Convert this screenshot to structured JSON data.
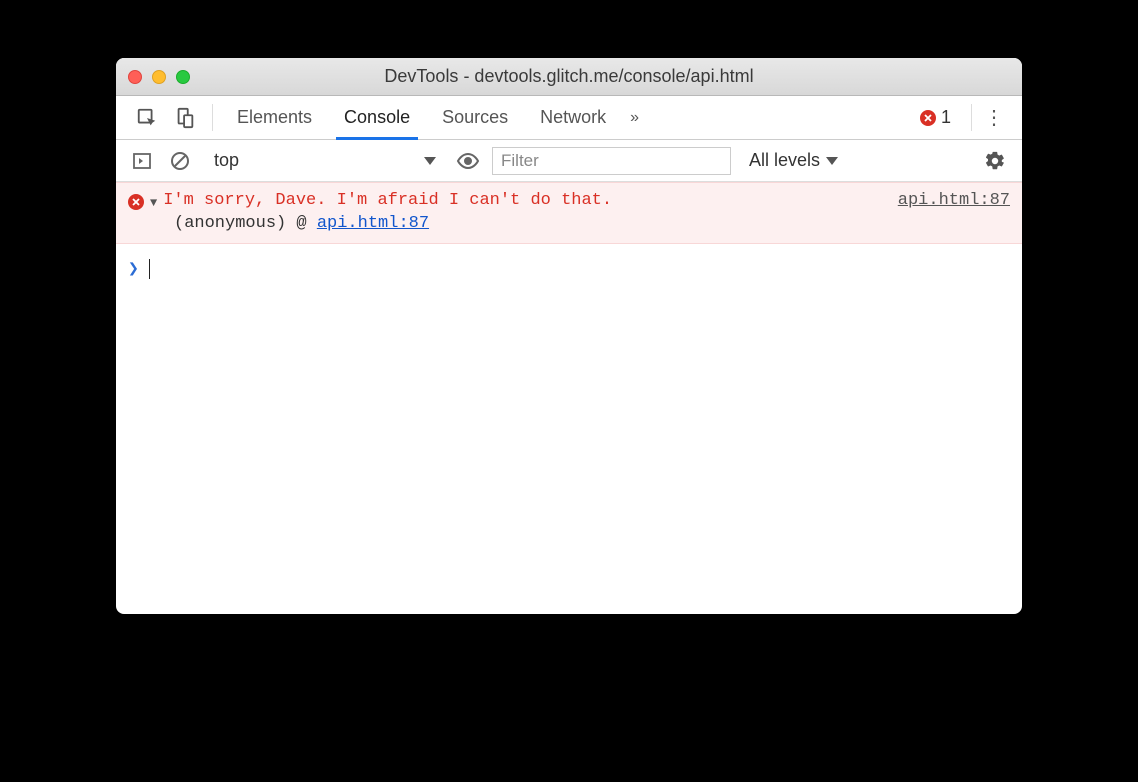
{
  "window": {
    "title": "DevTools - devtools.glitch.me/console/api.html"
  },
  "tabs": {
    "elements": "Elements",
    "console": "Console",
    "sources": "Sources",
    "network": "Network",
    "active": "Console"
  },
  "errors": {
    "count": "1"
  },
  "console_toolbar": {
    "context": "top",
    "filter_placeholder": "Filter",
    "levels": "All levels"
  },
  "log": {
    "error": {
      "message": "I'm sorry, Dave. I'm afraid I can't do that.",
      "source": "api.html:87",
      "stack_function": "(anonymous)",
      "stack_at": "@",
      "stack_link": "api.html:87"
    }
  },
  "icons": {
    "inspect": "inspect",
    "device": "device",
    "overflow": "»",
    "kebab": "⋮",
    "show_drawer": "show-drawer",
    "clear": "clear",
    "eye": "eye",
    "gear": "gear"
  }
}
